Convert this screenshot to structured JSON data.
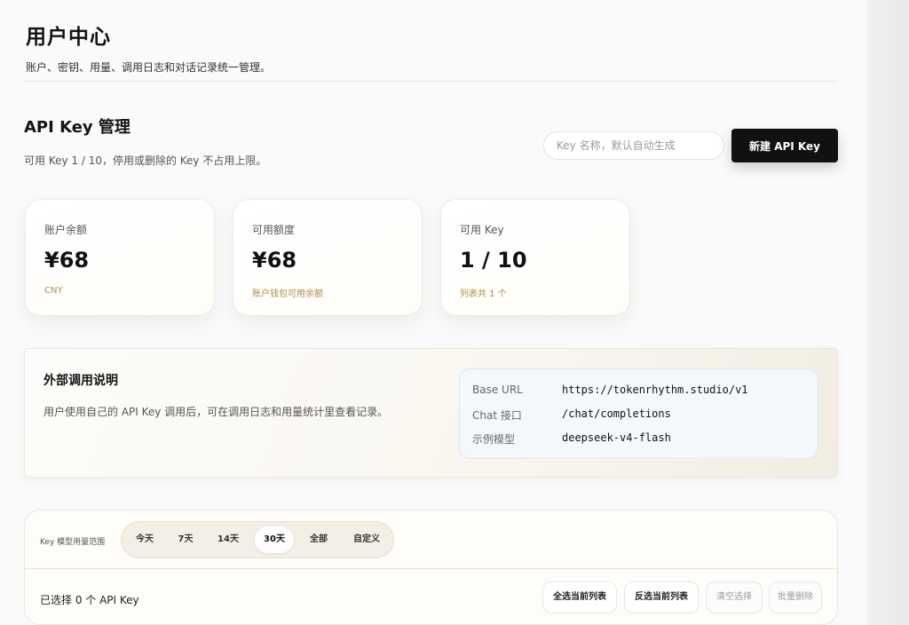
{
  "header": {
    "title": "用户中心",
    "subtitle": "账户、密钥、用量、调用日志和对话记录统一管理。"
  },
  "api_keys": {
    "title": "API Key 管理",
    "subtitle": "可用 Key 1 / 10，停用或删除的 Key 不占用上限。",
    "name_input_placeholder": "Key 名称，默认自动生成",
    "name_input_value": "",
    "new_button_label": "新建 API Key"
  },
  "stats": [
    {
      "label": "账户余额",
      "value": "¥68",
      "note": "CNY"
    },
    {
      "label": "可用额度",
      "value": "¥68",
      "note": "账户钱包可用余额"
    },
    {
      "label": "可用 Key",
      "value": "1 / 10",
      "note": "列表共 1 个"
    }
  ],
  "external_call": {
    "title": "外部调用说明",
    "description": "用户使用自己的 API Key 调用后，可在调用日志和用量统计里查看记录。",
    "rows": [
      {
        "key": "Base URL",
        "value": "https://tokenrhythm.studio/v1"
      },
      {
        "key": "Chat 接口",
        "value": "/chat/completions"
      },
      {
        "key": "示例模型",
        "value": "deepseek-v4-flash"
      }
    ]
  },
  "usage": {
    "range_label": "Key 模型用量范围",
    "ranges": [
      "今天",
      "7天",
      "14天",
      "30天",
      "全部",
      "自定义"
    ],
    "active_range": "30天",
    "selected_text": "已选择 0 个 API Key",
    "actions": [
      "全选当前列表",
      "反选当前列表",
      "清空选择",
      "批量删除"
    ]
  },
  "colors": {
    "accent": "#111111",
    "note_gold": "#b38a4a",
    "endpoint_bg": "#f4f8fd"
  }
}
